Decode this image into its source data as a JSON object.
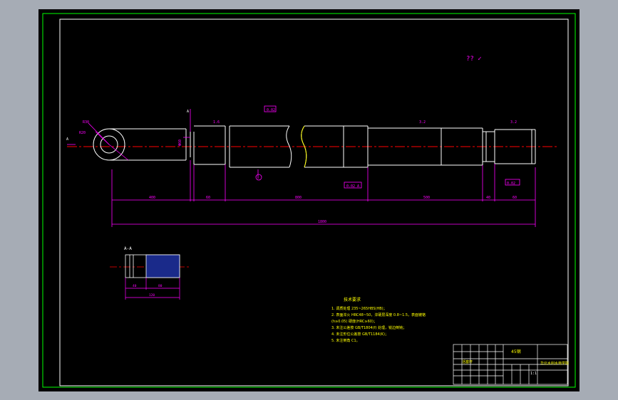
{
  "colors": {
    "background": "#000000",
    "viewport_bg": "#a6acb5",
    "frame": "#00ff00",
    "part_outline": "#ffffff",
    "dimension": "#ff00ff",
    "centerline": "#ff0000",
    "notes": "#ffff00",
    "section_fill": "#1a2a8a"
  },
  "roughness_symbol": "?? ✓",
  "section_label": "A-A",
  "tech_notes": {
    "title": "技术要求",
    "lines": [
      "1. 调质处理 235~265HBS(HB)；",
      "2. 表面淬火 HRC48~50，淬硬层深度 0.8~1.5，表面镀铬",
      "   (h≥0.05) 硬度(HRC≥60)；",
      "3. 未注公差按 GB/T1804(f) 处理，锐边倒钝；",
      "4. 未注形位公差按 GB/T1184(K)；",
      "5. 未注倒角 C1。"
    ]
  },
  "title_block": {
    "material": "45钢",
    "part_name": "活塞杆",
    "company": "华北水利水电学院",
    "scale": "1:1"
  }
}
